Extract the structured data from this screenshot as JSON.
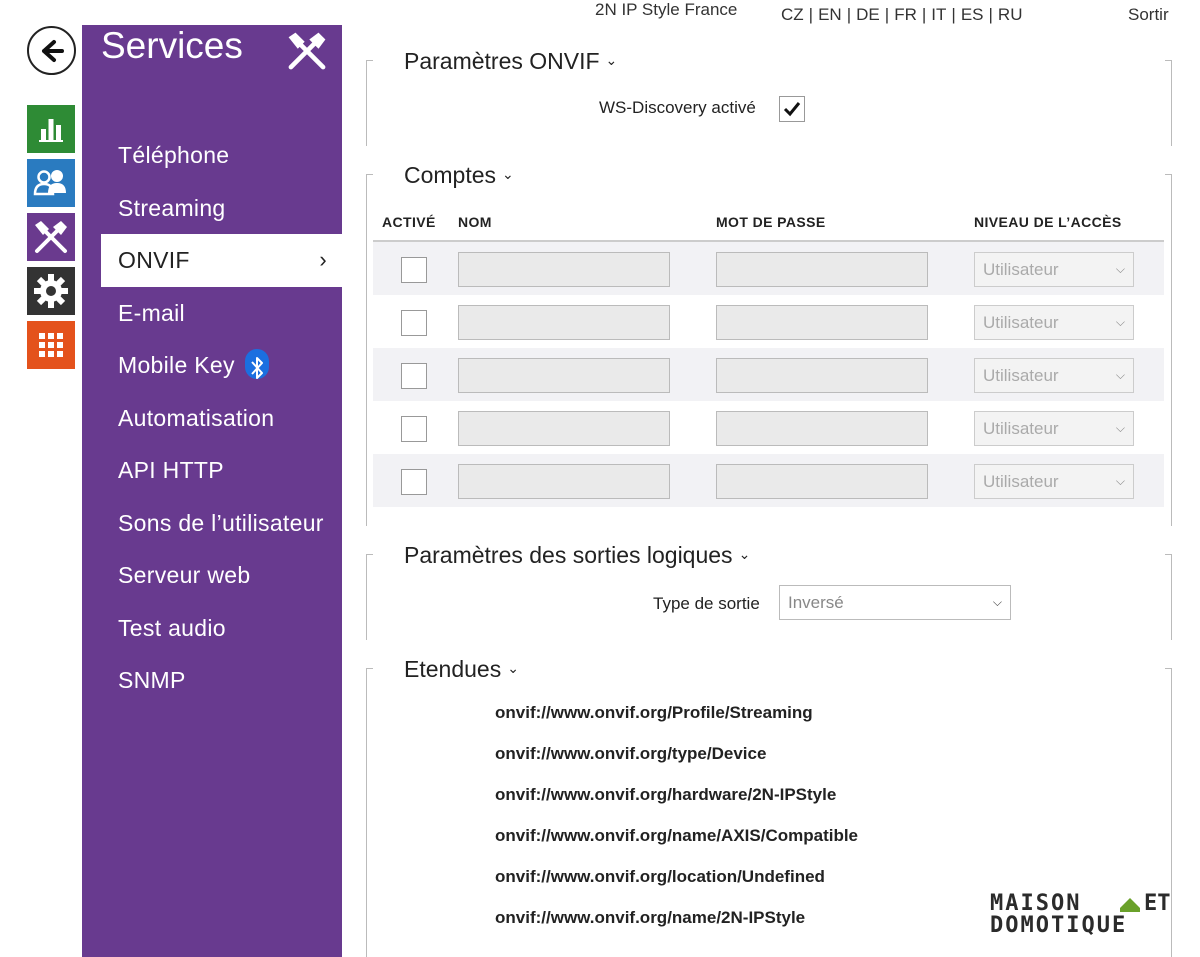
{
  "topbar": {
    "device_name": "2N IP Style France",
    "languages": [
      "CZ",
      "EN",
      "DE",
      "FR",
      "IT",
      "ES",
      "RU"
    ],
    "logout": "Sortir"
  },
  "icons": {
    "back": "arrow-left-icon",
    "status": "bar-chart-icon",
    "directory": "users-icon",
    "services": "tools-icon",
    "system": "gear-icon",
    "apps": "grid-icon"
  },
  "colors": {
    "sidebar": "#683a8f",
    "status_tile": "#2e8b35",
    "directory_tile": "#2a7bc0",
    "services_tile": "#6a3a8e",
    "system_tile": "#333333",
    "apps_tile": "#e4521c"
  },
  "sidebar": {
    "title": "Services",
    "items": [
      {
        "label": "Téléphone"
      },
      {
        "label": "Streaming"
      },
      {
        "label": "ONVIF",
        "active": true
      },
      {
        "label": "E-mail"
      },
      {
        "label": "Mobile Key"
      },
      {
        "label": "Automatisation"
      },
      {
        "label": "API HTTP"
      },
      {
        "label": "Sons de l’utilisateur"
      },
      {
        "label": "Serveur web"
      },
      {
        "label": "Test audio"
      },
      {
        "label": "SNMP"
      }
    ],
    "active_chevron": "›"
  },
  "onvif_params": {
    "title": "Paramètres ONVIF",
    "ws_discovery_label": "WS-Discovery activé",
    "ws_discovery_checked": true
  },
  "accounts": {
    "title": "Comptes",
    "columns": [
      "ACTIVÉ",
      "NOM",
      "MOT DE PASSE",
      "NIVEAU DE L’ACCÈS"
    ],
    "rows": [
      {
        "active": false,
        "name": "",
        "password": "",
        "level": "Utilisateur"
      },
      {
        "active": false,
        "name": "",
        "password": "",
        "level": "Utilisateur"
      },
      {
        "active": false,
        "name": "",
        "password": "",
        "level": "Utilisateur"
      },
      {
        "active": false,
        "name": "",
        "password": "",
        "level": "Utilisateur"
      },
      {
        "active": false,
        "name": "",
        "password": "",
        "level": "Utilisateur"
      }
    ]
  },
  "outputs": {
    "title": "Paramètres des sorties logiques",
    "type_label": "Type de sortie",
    "type_value": "Inversé"
  },
  "scopes": {
    "title": "Etendues",
    "items": [
      "onvif://www.onvif.org/Profile/Streaming",
      "onvif://www.onvif.org/type/Device",
      "onvif://www.onvif.org/hardware/2N-IPStyle",
      "onvif://www.onvif.org/name/AXIS/Compatible",
      "onvif://www.onvif.org/location/Undefined",
      "onvif://www.onvif.org/name/2N-IPStyle"
    ]
  },
  "watermark": {
    "line1": "MAISON ET",
    "line2": "DOMOTIQUE"
  }
}
